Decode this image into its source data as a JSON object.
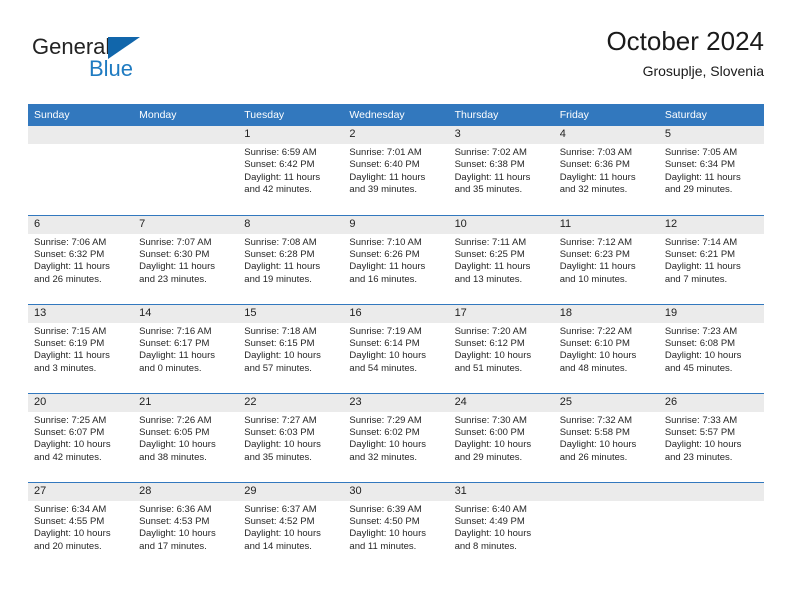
{
  "logo": {
    "word_top": "General",
    "word_bottom": "Blue",
    "triangle_color": "#1166ab",
    "blue_text_color": "#1f7bc1"
  },
  "header": {
    "title": "October 2024",
    "subtitle": "Grosuplje, Slovenia"
  },
  "theme": {
    "header_bar": "#3278be",
    "daynum_band": "#ebebeb",
    "grid_line": "#3278be",
    "text": "#262626"
  },
  "weekdays": [
    "Sunday",
    "Monday",
    "Tuesday",
    "Wednesday",
    "Thursday",
    "Friday",
    "Saturday"
  ],
  "weeks": [
    [
      {
        "day": "",
        "sunrise": "",
        "sunset": "",
        "daylight1": "",
        "daylight2": ""
      },
      {
        "day": "",
        "sunrise": "",
        "sunset": "",
        "daylight1": "",
        "daylight2": ""
      },
      {
        "day": "1",
        "sunrise": "Sunrise: 6:59 AM",
        "sunset": "Sunset: 6:42 PM",
        "daylight1": "Daylight: 11 hours",
        "daylight2": "and 42 minutes."
      },
      {
        "day": "2",
        "sunrise": "Sunrise: 7:01 AM",
        "sunset": "Sunset: 6:40 PM",
        "daylight1": "Daylight: 11 hours",
        "daylight2": "and 39 minutes."
      },
      {
        "day": "3",
        "sunrise": "Sunrise: 7:02 AM",
        "sunset": "Sunset: 6:38 PM",
        "daylight1": "Daylight: 11 hours",
        "daylight2": "and 35 minutes."
      },
      {
        "day": "4",
        "sunrise": "Sunrise: 7:03 AM",
        "sunset": "Sunset: 6:36 PM",
        "daylight1": "Daylight: 11 hours",
        "daylight2": "and 32 minutes."
      },
      {
        "day": "5",
        "sunrise": "Sunrise: 7:05 AM",
        "sunset": "Sunset: 6:34 PM",
        "daylight1": "Daylight: 11 hours",
        "daylight2": "and 29 minutes."
      }
    ],
    [
      {
        "day": "6",
        "sunrise": "Sunrise: 7:06 AM",
        "sunset": "Sunset: 6:32 PM",
        "daylight1": "Daylight: 11 hours",
        "daylight2": "and 26 minutes."
      },
      {
        "day": "7",
        "sunrise": "Sunrise: 7:07 AM",
        "sunset": "Sunset: 6:30 PM",
        "daylight1": "Daylight: 11 hours",
        "daylight2": "and 23 minutes."
      },
      {
        "day": "8",
        "sunrise": "Sunrise: 7:08 AM",
        "sunset": "Sunset: 6:28 PM",
        "daylight1": "Daylight: 11 hours",
        "daylight2": "and 19 minutes."
      },
      {
        "day": "9",
        "sunrise": "Sunrise: 7:10 AM",
        "sunset": "Sunset: 6:26 PM",
        "daylight1": "Daylight: 11 hours",
        "daylight2": "and 16 minutes."
      },
      {
        "day": "10",
        "sunrise": "Sunrise: 7:11 AM",
        "sunset": "Sunset: 6:25 PM",
        "daylight1": "Daylight: 11 hours",
        "daylight2": "and 13 minutes."
      },
      {
        "day": "11",
        "sunrise": "Sunrise: 7:12 AM",
        "sunset": "Sunset: 6:23 PM",
        "daylight1": "Daylight: 11 hours",
        "daylight2": "and 10 minutes."
      },
      {
        "day": "12",
        "sunrise": "Sunrise: 7:14 AM",
        "sunset": "Sunset: 6:21 PM",
        "daylight1": "Daylight: 11 hours",
        "daylight2": "and 7 minutes."
      }
    ],
    [
      {
        "day": "13",
        "sunrise": "Sunrise: 7:15 AM",
        "sunset": "Sunset: 6:19 PM",
        "daylight1": "Daylight: 11 hours",
        "daylight2": "and 3 minutes."
      },
      {
        "day": "14",
        "sunrise": "Sunrise: 7:16 AM",
        "sunset": "Sunset: 6:17 PM",
        "daylight1": "Daylight: 11 hours",
        "daylight2": "and 0 minutes."
      },
      {
        "day": "15",
        "sunrise": "Sunrise: 7:18 AM",
        "sunset": "Sunset: 6:15 PM",
        "daylight1": "Daylight: 10 hours",
        "daylight2": "and 57 minutes."
      },
      {
        "day": "16",
        "sunrise": "Sunrise: 7:19 AM",
        "sunset": "Sunset: 6:14 PM",
        "daylight1": "Daylight: 10 hours",
        "daylight2": "and 54 minutes."
      },
      {
        "day": "17",
        "sunrise": "Sunrise: 7:20 AM",
        "sunset": "Sunset: 6:12 PM",
        "daylight1": "Daylight: 10 hours",
        "daylight2": "and 51 minutes."
      },
      {
        "day": "18",
        "sunrise": "Sunrise: 7:22 AM",
        "sunset": "Sunset: 6:10 PM",
        "daylight1": "Daylight: 10 hours",
        "daylight2": "and 48 minutes."
      },
      {
        "day": "19",
        "sunrise": "Sunrise: 7:23 AM",
        "sunset": "Sunset: 6:08 PM",
        "daylight1": "Daylight: 10 hours",
        "daylight2": "and 45 minutes."
      }
    ],
    [
      {
        "day": "20",
        "sunrise": "Sunrise: 7:25 AM",
        "sunset": "Sunset: 6:07 PM",
        "daylight1": "Daylight: 10 hours",
        "daylight2": "and 42 minutes."
      },
      {
        "day": "21",
        "sunrise": "Sunrise: 7:26 AM",
        "sunset": "Sunset: 6:05 PM",
        "daylight1": "Daylight: 10 hours",
        "daylight2": "and 38 minutes."
      },
      {
        "day": "22",
        "sunrise": "Sunrise: 7:27 AM",
        "sunset": "Sunset: 6:03 PM",
        "daylight1": "Daylight: 10 hours",
        "daylight2": "and 35 minutes."
      },
      {
        "day": "23",
        "sunrise": "Sunrise: 7:29 AM",
        "sunset": "Sunset: 6:02 PM",
        "daylight1": "Daylight: 10 hours",
        "daylight2": "and 32 minutes."
      },
      {
        "day": "24",
        "sunrise": "Sunrise: 7:30 AM",
        "sunset": "Sunset: 6:00 PM",
        "daylight1": "Daylight: 10 hours",
        "daylight2": "and 29 minutes."
      },
      {
        "day": "25",
        "sunrise": "Sunrise: 7:32 AM",
        "sunset": "Sunset: 5:58 PM",
        "daylight1": "Daylight: 10 hours",
        "daylight2": "and 26 minutes."
      },
      {
        "day": "26",
        "sunrise": "Sunrise: 7:33 AM",
        "sunset": "Sunset: 5:57 PM",
        "daylight1": "Daylight: 10 hours",
        "daylight2": "and 23 minutes."
      }
    ],
    [
      {
        "day": "27",
        "sunrise": "Sunrise: 6:34 AM",
        "sunset": "Sunset: 4:55 PM",
        "daylight1": "Daylight: 10 hours",
        "daylight2": "and 20 minutes."
      },
      {
        "day": "28",
        "sunrise": "Sunrise: 6:36 AM",
        "sunset": "Sunset: 4:53 PM",
        "daylight1": "Daylight: 10 hours",
        "daylight2": "and 17 minutes."
      },
      {
        "day": "29",
        "sunrise": "Sunrise: 6:37 AM",
        "sunset": "Sunset: 4:52 PM",
        "daylight1": "Daylight: 10 hours",
        "daylight2": "and 14 minutes."
      },
      {
        "day": "30",
        "sunrise": "Sunrise: 6:39 AM",
        "sunset": "Sunset: 4:50 PM",
        "daylight1": "Daylight: 10 hours",
        "daylight2": "and 11 minutes."
      },
      {
        "day": "31",
        "sunrise": "Sunrise: 6:40 AM",
        "sunset": "Sunset: 4:49 PM",
        "daylight1": "Daylight: 10 hours",
        "daylight2": "and 8 minutes."
      },
      {
        "day": "",
        "sunrise": "",
        "sunset": "",
        "daylight1": "",
        "daylight2": ""
      },
      {
        "day": "",
        "sunrise": "",
        "sunset": "",
        "daylight1": "",
        "daylight2": ""
      }
    ]
  ]
}
